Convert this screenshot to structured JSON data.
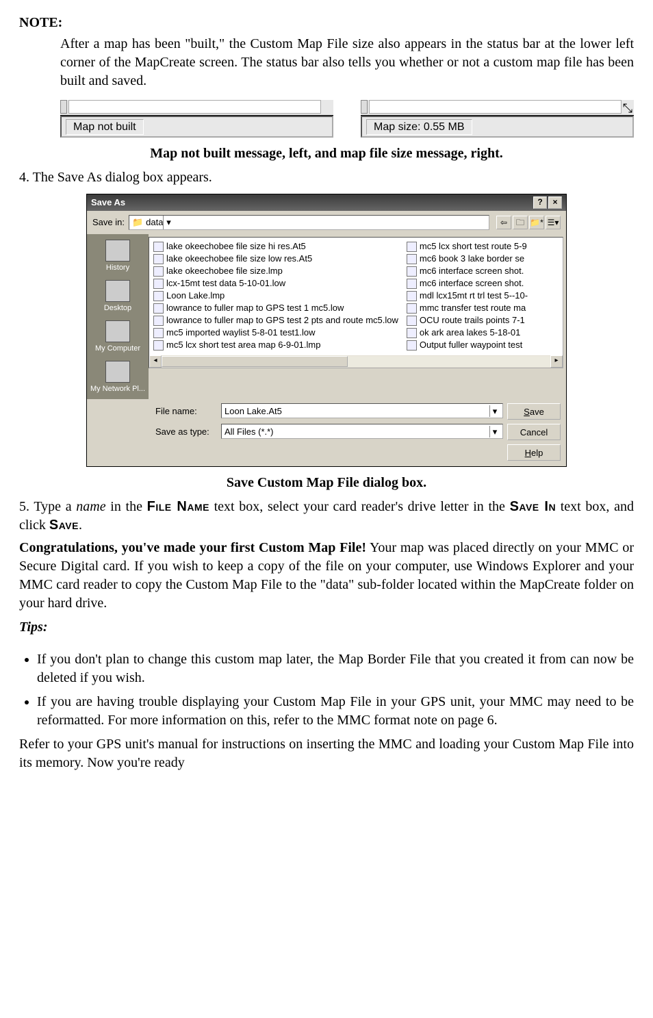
{
  "note": {
    "heading": "NOTE:",
    "body": "After a map has been \"built,\" the Custom Map File size also appears in the status bar at the lower left corner of the MapCreate screen. The status bar also tells you whether or not a custom map file has been built and saved."
  },
  "statusbar": {
    "left_text": "Map not built",
    "right_text": "Map size: 0.55 MB",
    "right_grip": "⤡"
  },
  "caption1": "Map not built message, left, and map file size message, right.",
  "step4": "4. The Save As dialog box appears.",
  "dialog": {
    "title": "Save As",
    "save_in_label": "Save in:",
    "save_in_value": "data",
    "places": [
      "History",
      "Desktop",
      "My Computer",
      "My Network Pl..."
    ],
    "files_col1": [
      "lake okeechobee file size hi res.At5",
      "lake okeechobee file size low res.At5",
      "lake okeechobee file size.lmp",
      "lcx-15mt test data 5-10-01.low",
      "Loon Lake.lmp",
      "lowrance to fuller map to GPS test 1 mc5.low",
      "lowrance to fuller map to GPS test 2 pts and route mc5.low",
      "mc5 imported waylist 5-8-01 test1.low",
      "mc5 lcx short test area map 6-9-01.lmp"
    ],
    "files_col2": [
      "mc5 lcx short test route 5-9",
      "mc6 book 3 lake border se",
      "mc6 interface screen shot.",
      "mc6 interface screen shot.",
      "mdl lcx15mt rt trl test 5--10-",
      "mmc transfer test route ma",
      "OCU route trails points 7-1",
      "ok ark area lakes 5-18-01",
      "Output fuller waypoint test"
    ],
    "file_name_label": "File name:",
    "file_name_value": "Loon Lake.At5",
    "file_type_label": "Save as type:",
    "file_type_value": "All Files (*.*)",
    "save_btn": "Save",
    "cancel_btn": "Cancel",
    "help_btn": "Help"
  },
  "caption2": "Save Custom Map File dialog box.",
  "step5_a": "5. Type a ",
  "step5_b": "name",
  "step5_c": " in the ",
  "sc_file_name": "File Name",
  "step5_d": " text box, select your card reader's drive letter in the ",
  "sc_save_in": "Save In",
  "step5_e": " text box, and click ",
  "sc_save": "Save",
  "step5_f": ".",
  "congrats_lead": "Congratulations, you've made your first Custom Map File!",
  "congrats_rest": " Your map was placed directly on your MMC or Secure Digital card. If you wish to keep a copy of the file on your computer, use Windows Explorer and your MMC card reader to copy the Custom Map File to the \"data\" sub-folder located within the MapCreate folder on your hard drive.",
  "tips_heading": "Tips:",
  "tips": [
    "If you don't plan to change this custom map later, the Map Border File that you created it from can now be deleted if you wish.",
    "If you are having trouble displaying your Custom Map File in your GPS unit, your MMC may need to be reformatted. For more information on this, refer to the MMC format note on page 6."
  ],
  "closing": "Refer to your GPS unit's manual for instructions on inserting the MMC and loading your Custom Map File into its memory. Now you're ready"
}
